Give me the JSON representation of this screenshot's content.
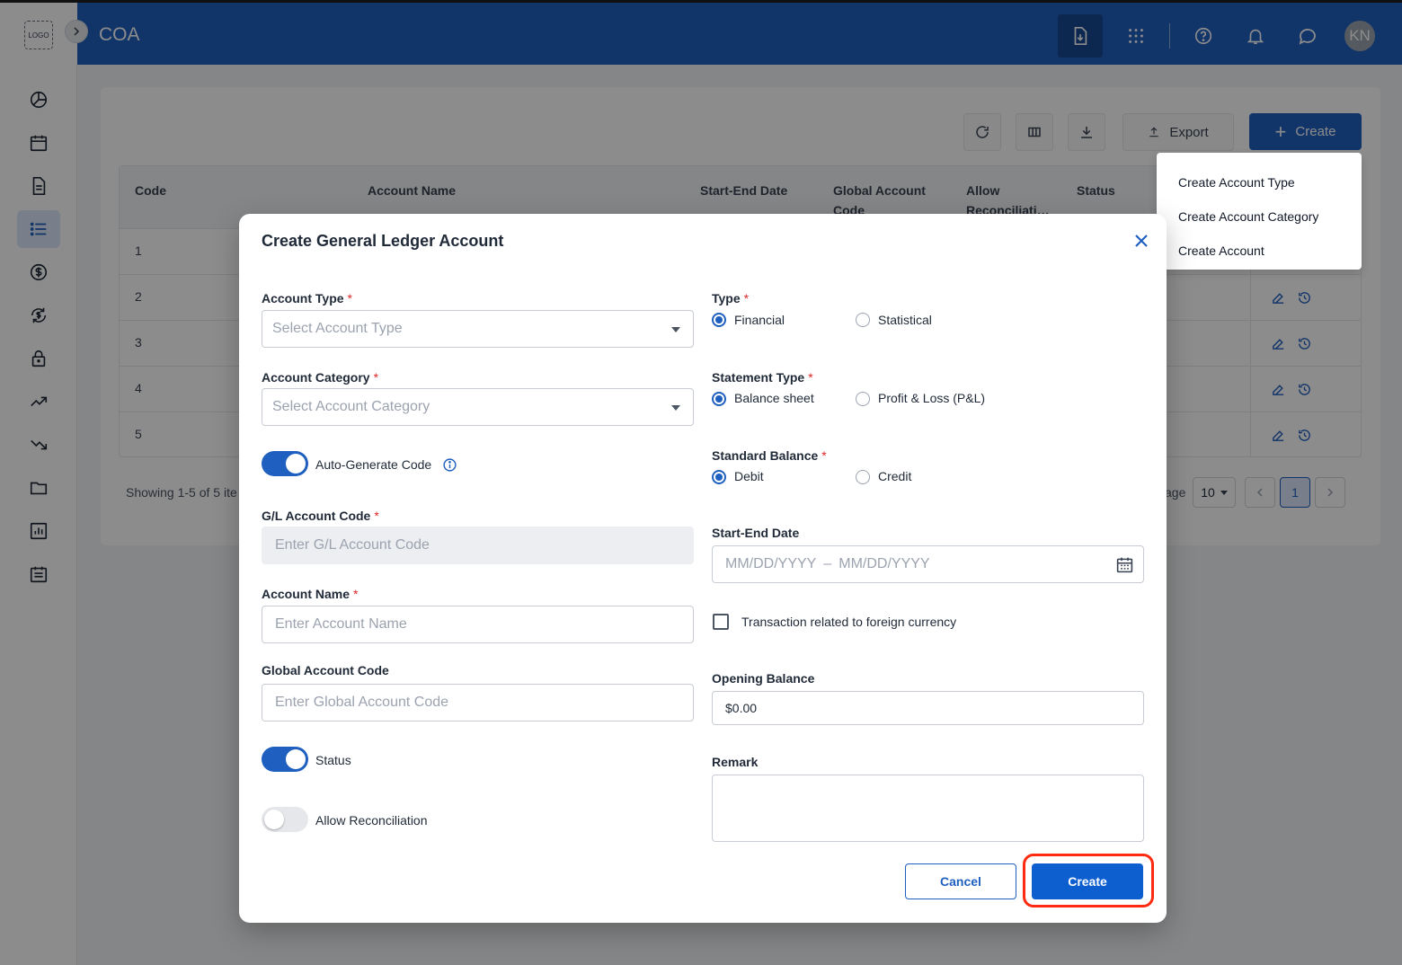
{
  "app": {
    "logo_text": "LOGO",
    "title": "COA",
    "avatar_initials": "KN"
  },
  "toolbar": {
    "export_label": "Export",
    "create_label": "Create"
  },
  "create_menu": {
    "items": [
      "Create Account Type",
      "Create Account Category",
      "Create Account"
    ]
  },
  "table": {
    "headers": {
      "code": "Code",
      "account_name": "Account Name",
      "start_end_date": "Start-End Date",
      "global_code_l1": "Global Account",
      "global_code_l2": "Code",
      "allow_recon_l1": "Allow",
      "allow_recon_l2": "Reconciliati…",
      "status": "Status"
    },
    "rows": [
      "1",
      "2",
      "3",
      "4",
      "5"
    ],
    "footer_text": "Showing 1-5 of 5 ite",
    "per_page_label": "age",
    "per_page_value": "10",
    "current_page": "1"
  },
  "modal": {
    "title": "Create General Ledger Account",
    "account_type": {
      "label": "Account Type",
      "placeholder": "Select Account Type"
    },
    "account_category": {
      "label": "Account Category",
      "placeholder": "Select Account Category"
    },
    "auto_generate": {
      "label": "Auto-Generate Code",
      "on": true
    },
    "gl_code": {
      "label": "G/L Account Code",
      "placeholder": "Enter G/L Account Code"
    },
    "account_name": {
      "label": "Account Name",
      "placeholder": "Enter Account Name"
    },
    "global_code": {
      "label": "Global Account Code",
      "placeholder": "Enter Global Account Code"
    },
    "status": {
      "label": "Status",
      "on": true
    },
    "allow_reconciliation": {
      "label": "Allow Reconciliation",
      "on": false
    },
    "type": {
      "label": "Type",
      "options": [
        "Financial",
        "Statistical"
      ],
      "selected": "Financial"
    },
    "statement_type": {
      "label": "Statement Type",
      "options": [
        "Balance sheet",
        "Profit & Loss (P&L)"
      ],
      "selected": "Balance sheet"
    },
    "standard_balance": {
      "label": "Standard Balance",
      "options": [
        "Debit",
        "Credit"
      ],
      "selected": "Debit"
    },
    "start_end_date": {
      "label": "Start-End Date",
      "start_placeholder": "MM/DD/YYYY",
      "separator": "–",
      "end_placeholder": "MM/DD/YYYY"
    },
    "foreign_currency": {
      "label": "Transaction related to foreign currency",
      "checked": false
    },
    "opening_balance": {
      "label": "Opening Balance",
      "value": "$0.00"
    },
    "remark": {
      "label": "Remark",
      "value": ""
    },
    "cancel_label": "Cancel",
    "create_label": "Create"
  },
  "colors": {
    "primary": "#1f5fbf",
    "required": "#dc2626",
    "highlight": "#ff2a12"
  }
}
